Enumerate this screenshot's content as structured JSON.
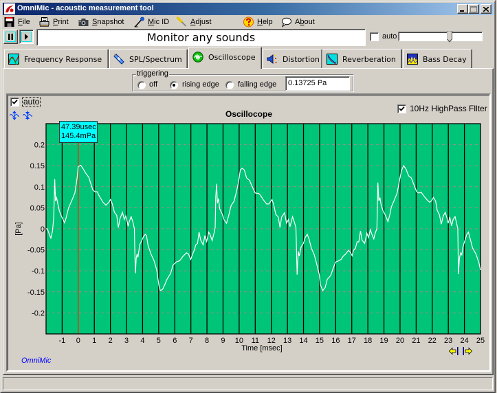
{
  "window": {
    "title": "OmniMic - acoustic measurement tool"
  },
  "menu": {
    "items": [
      {
        "label": "File",
        "mnemonic": 0,
        "icon": "floppy-disk-icon"
      },
      {
        "label": "Print",
        "mnemonic": 0,
        "icon": "printer-icon"
      },
      {
        "label": "Snapshot",
        "mnemonic": 0,
        "icon": "camera-icon"
      },
      {
        "label": "Mic ID",
        "mnemonic": 0,
        "icon": "microphone-icon"
      },
      {
        "label": "Adjust",
        "mnemonic": 0,
        "icon": "screwdriver-icon"
      },
      {
        "label": "Help",
        "mnemonic": 0,
        "icon": "help-icon"
      },
      {
        "label": "About",
        "mnemonic": 1,
        "icon": "speech-bubble-icon"
      }
    ]
  },
  "toolbar": {
    "pause_icon": "pause-icon",
    "play_icon": "play-icon",
    "play_pressed": true,
    "status_text": "Monitor any sounds",
    "auto_label": "auto",
    "auto_checked": false,
    "level_slider": 0.62
  },
  "tabs": [
    {
      "label": "Frequency Response",
      "icon": "frequency-response-icon",
      "selected": false
    },
    {
      "label": "SPL/Spectrum",
      "icon": "spl-meter-icon",
      "selected": false
    },
    {
      "label": "Oscilloscope",
      "icon": "oscilloscope-icon",
      "selected": true
    },
    {
      "label": "Distortion",
      "icon": "distortion-icon",
      "selected": false
    },
    {
      "label": "Reverberation",
      "icon": "reverberation-icon",
      "selected": false
    },
    {
      "label": "Bass Decay",
      "icon": "bass-decay-icon",
      "selected": false
    }
  ],
  "triggering": {
    "legend": "triggering",
    "options": [
      {
        "label": "off",
        "selected": false
      },
      {
        "label": "rising edge",
        "selected": true
      },
      {
        "label": "falling edge",
        "selected": false
      }
    ],
    "level": "0.13725 Pa"
  },
  "graph": {
    "auto_label": "auto",
    "auto_checked": true,
    "highpass_label": "10Hz HighPass Fllter",
    "highpass_checked": true,
    "cursor_readout": {
      "time": "47.39usec",
      "value": "145.4mPa"
    },
    "brand": "OmniMic"
  },
  "statusbar": {
    "text": ""
  },
  "colors": {
    "plot_background": "#00c477",
    "trace": "#ffffff",
    "cursor": "#ff2000",
    "readout_background": "#00ffff",
    "brand_text": "#0000ff",
    "titlebar_start": "#0a246a",
    "titlebar_end": "#a6caf0"
  },
  "chart_data": {
    "type": "line",
    "title": "Oscillocope",
    "xlabel": "Time [msec]",
    "ylabel": "[Pa]",
    "xlim": [
      -2,
      25
    ],
    "ylim": [
      -0.25,
      0.25
    ],
    "grid": true,
    "cursor_x": 0,
    "xticks": [
      -1,
      0,
      1,
      2,
      3,
      4,
      5,
      6,
      7,
      8,
      9,
      10,
      11,
      12,
      13,
      14,
      15,
      16,
      17,
      18,
      19,
      20,
      21,
      22,
      23,
      24,
      25
    ],
    "xtick_labels": [
      "-1",
      "0",
      "1",
      "2",
      "3",
      "4",
      "5",
      "6",
      "7",
      "8",
      "9",
      "10",
      "11",
      "12",
      "13",
      "14",
      "15",
      "16",
      "17",
      "18",
      "19",
      "20",
      "21",
      "22",
      "23",
      "24",
      "25"
    ],
    "yticks": [
      0.2,
      0.15,
      0.1,
      0.05,
      0,
      -0.05,
      -0.1,
      -0.15,
      -0.2
    ],
    "ytick_labels": [
      "0.2",
      "0.15",
      "0.1",
      "0.05",
      "0",
      "-0.05",
      "-0.1",
      "-0.15",
      "-0.2"
    ],
    "series": [
      {
        "name": "signal",
        "x": [
          -2.0,
          -1.92,
          -1.8,
          -1.7,
          -1.6,
          -1.52,
          -1.46,
          -1.41,
          -1.34,
          -1.26,
          -1.17,
          -1.02,
          -0.85,
          -0.74,
          -0.6,
          -0.38,
          -0.21,
          -0.07,
          0,
          0.16,
          0.3,
          0.47,
          0.66,
          0.76,
          0.9,
          1.04,
          1.18,
          1.32,
          1.54,
          1.72,
          1.9,
          2.0,
          2.1,
          2.25,
          2.39,
          2.49,
          2.6,
          2.75,
          2.86,
          2.96,
          3.1,
          3.17,
          3.29,
          3.39,
          3.49,
          3.53,
          3.56,
          3.6,
          3.66,
          3.71,
          3.82,
          3.96,
          4.05,
          4.17,
          4.24,
          4.34,
          4.52,
          4.71,
          4.88,
          5.02,
          5.1,
          5.24,
          5.38,
          5.52,
          5.74,
          5.88,
          6.09,
          6.3,
          6.52,
          6.73,
          6.85,
          6.99,
          7.09,
          7.23,
          7.3,
          7.41,
          7.51,
          7.61,
          7.76,
          7.87,
          7.98,
          8.11,
          8.19,
          8.32,
          8.44,
          8.51,
          8.55,
          8.6,
          8.65,
          8.72,
          8.79,
          8.94,
          9.05,
          9.22,
          9.36,
          9.5,
          9.69,
          9.86,
          9.97,
          10.07,
          10.19,
          10.32,
          10.46,
          10.65,
          10.79,
          11.0,
          11.22,
          11.32,
          11.5,
          11.71,
          11.85,
          12.04,
          12.14,
          12.28,
          12.43,
          12.54,
          12.64,
          12.82,
          12.95,
          13.06,
          13.16,
          13.32,
          13.42,
          13.53,
          13.6,
          13.68,
          13.74,
          13.85,
          13.99,
          14.1,
          14.23,
          14.34,
          14.49,
          14.67,
          14.84,
          14.98,
          15.05,
          15.19,
          15.34,
          15.48,
          15.69,
          15.83,
          16.0,
          16.19,
          16.33,
          16.47,
          16.62,
          16.8,
          16.93,
          17.02,
          17.11,
          17.23,
          17.33,
          17.44,
          17.54,
          17.64,
          17.8,
          17.94,
          18.04,
          18.15,
          18.25,
          18.37,
          18.46,
          18.56,
          18.62,
          18.68,
          18.75,
          18.82,
          18.93,
          19.08,
          19.25,
          19.36,
          19.46,
          19.65,
          19.82,
          19.96,
          20.08,
          20.22,
          20.36,
          20.53,
          20.7,
          20.84,
          21.03,
          21.17,
          21.31,
          21.5,
          21.67,
          21.84,
          21.95,
          22.07,
          22.21,
          22.31,
          22.45,
          22.56,
          22.69,
          22.81,
          22.92,
          22.99,
          23.09,
          23.2,
          23.3,
          23.42,
          23.49,
          23.59,
          23.63,
          23.69,
          23.77,
          23.84,
          23.91,
          24.01,
          24.15,
          24.25,
          24.36,
          24.51,
          24.72,
          24.9,
          25.0
        ],
        "y": [
          0.0,
          0.0,
          -0.013,
          -0.022,
          -0.005,
          0.028,
          0.118,
          0.066,
          0.074,
          0.058,
          0.042,
          0.028,
          0.014,
          0.028,
          0.05,
          0.069,
          0.085,
          0.121,
          0.148,
          0.151,
          0.143,
          0.132,
          0.122,
          0.11,
          0.093,
          0.088,
          0.088,
          0.077,
          0.063,
          0.056,
          0.063,
          0.07,
          0.061,
          0.039,
          0.032,
          0.003,
          0.025,
          0.039,
          0.022,
          0.031,
          0.006,
          0.017,
          0.029,
          0.017,
          0.0,
          -0.073,
          -0.106,
          -0.07,
          -0.06,
          -0.068,
          -0.038,
          -0.027,
          -0.019,
          -0.013,
          -0.016,
          -0.04,
          -0.06,
          -0.076,
          -0.098,
          -0.136,
          -0.147,
          -0.144,
          -0.133,
          -0.12,
          -0.106,
          -0.087,
          -0.079,
          -0.076,
          -0.065,
          -0.057,
          -0.06,
          -0.073,
          -0.062,
          -0.049,
          -0.038,
          -0.035,
          -0.008,
          -0.027,
          -0.038,
          -0.016,
          -0.03,
          -0.008,
          -0.013,
          -0.028,
          -0.01,
          0.003,
          0.077,
          0.107,
          0.061,
          0.072,
          0.047,
          0.036,
          0.022,
          0.013,
          0.033,
          0.055,
          0.066,
          0.093,
          0.113,
          0.14,
          0.144,
          0.14,
          0.121,
          0.115,
          0.102,
          0.085,
          0.084,
          0.08,
          0.069,
          0.059,
          0.059,
          0.07,
          0.058,
          0.034,
          0.028,
          0.003,
          0.028,
          0.038,
          0.013,
          0.022,
          0.005,
          0.029,
          0.017,
          0.003,
          -0.109,
          -0.054,
          -0.065,
          -0.043,
          -0.035,
          -0.021,
          -0.013,
          -0.024,
          -0.046,
          -0.062,
          -0.087,
          -0.109,
          -0.133,
          -0.147,
          -0.14,
          -0.12,
          -0.111,
          -0.095,
          -0.079,
          -0.076,
          -0.073,
          -0.065,
          -0.06,
          -0.051,
          -0.057,
          -0.064,
          -0.051,
          -0.046,
          -0.031,
          -0.031,
          -0.005,
          -0.027,
          -0.035,
          -0.01,
          -0.021,
          -0.002,
          -0.013,
          -0.024,
          -0.01,
          0.0,
          0.11,
          0.066,
          0.074,
          0.058,
          0.044,
          0.033,
          0.017,
          0.033,
          0.052,
          0.069,
          0.085,
          0.113,
          0.137,
          0.15,
          0.143,
          0.126,
          0.121,
          0.107,
          0.088,
          0.085,
          0.087,
          0.077,
          0.069,
          0.063,
          0.066,
          0.075,
          0.066,
          0.044,
          0.033,
          0.011,
          0.031,
          0.039,
          0.025,
          0.013,
          0.028,
          0.007,
          0.022,
          0.029,
          0.017,
          0.0,
          -0.108,
          -0.07,
          -0.057,
          -0.062,
          -0.043,
          -0.03,
          -0.013,
          -0.008,
          -0.024,
          -0.046,
          -0.06,
          -0.081,
          -0.098
        ]
      }
    ]
  }
}
